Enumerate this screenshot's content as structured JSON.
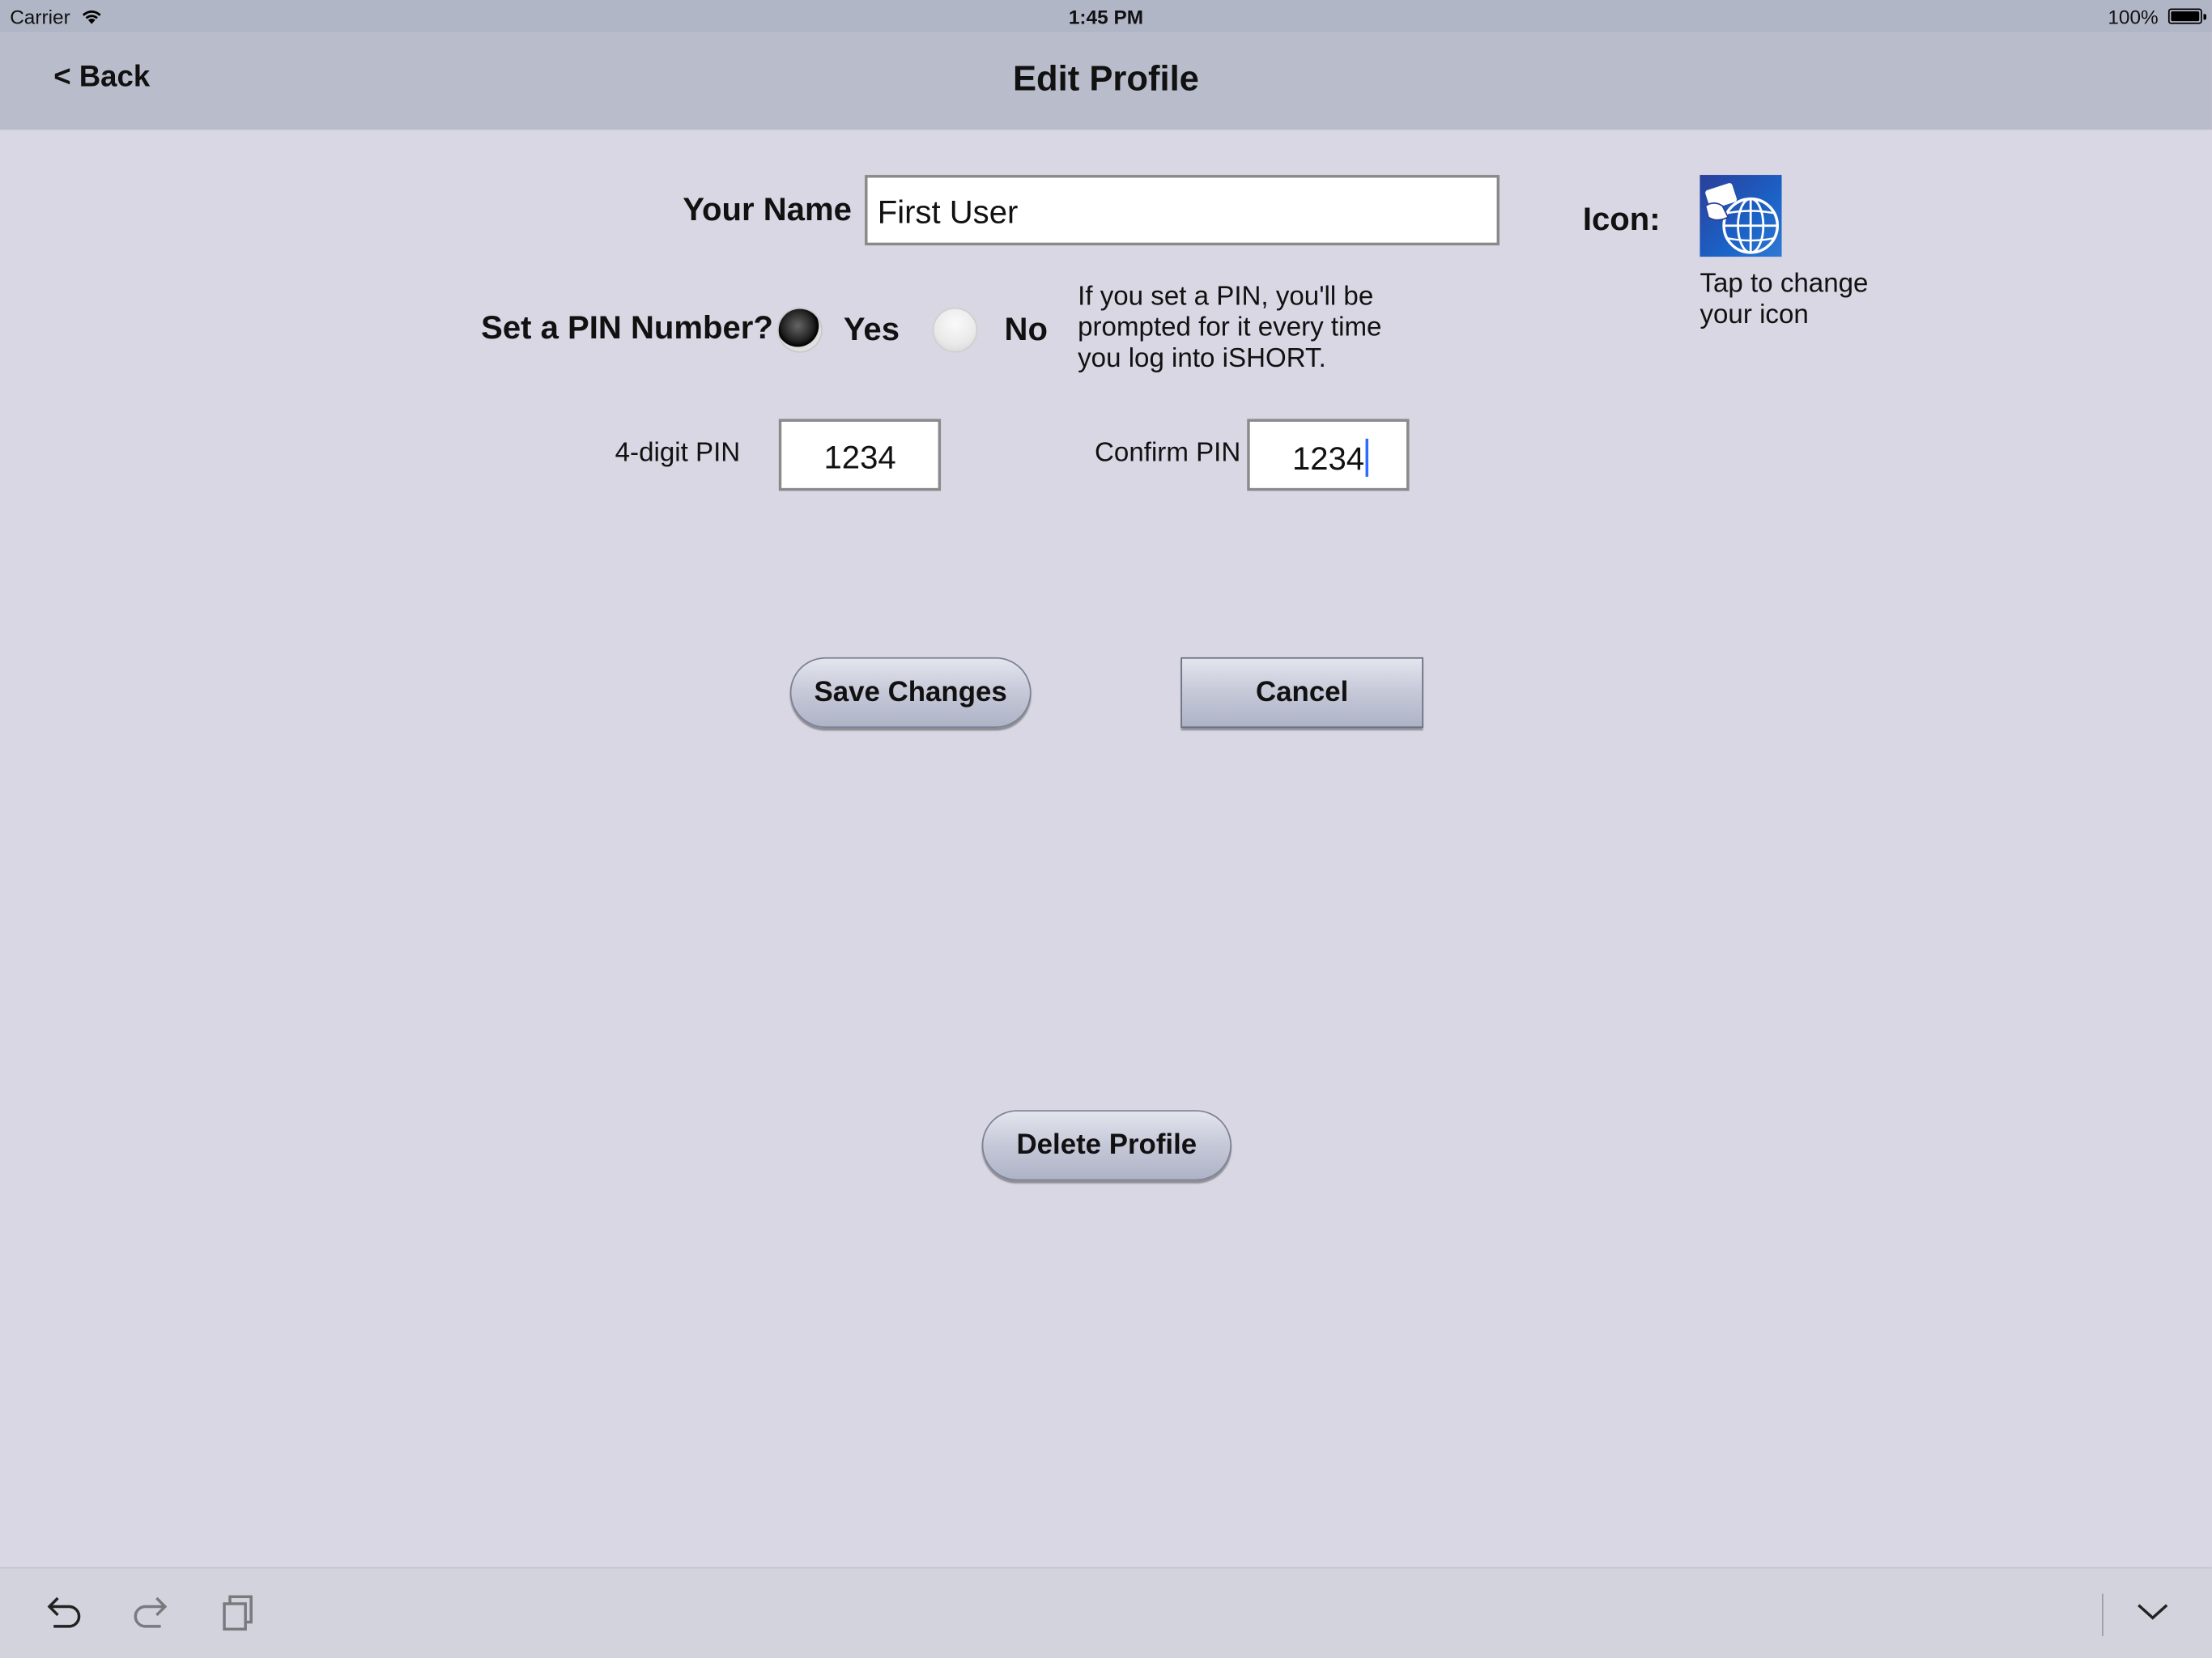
{
  "status_bar": {
    "carrier": "Carrier",
    "time": "1:45 PM",
    "battery": "100%"
  },
  "nav": {
    "back_label": "< Back",
    "title": "Edit Profile"
  },
  "form": {
    "name_label": "Your Name",
    "name_value": "First User",
    "icon_label": "Icon:",
    "icon_hint": "Tap to change your icon",
    "pin_question": "Set a PIN Number?",
    "yes_label": "Yes",
    "no_label": "No",
    "pin_selected": "Yes",
    "pin_hint": "If you set a PIN, you'll be prompted for it every time you log into iSHORT.",
    "pin_label": "4-digit PIN",
    "pin_value": "1234",
    "confirm_label": "Confirm PIN",
    "confirm_value": "1234"
  },
  "buttons": {
    "save": "Save Changes",
    "cancel": "Cancel",
    "delete": "Delete Profile"
  },
  "shortcut_bar": {
    "icons": [
      "undo-icon",
      "redo-icon",
      "paste-icon",
      "keyboard-dismiss-icon"
    ]
  }
}
